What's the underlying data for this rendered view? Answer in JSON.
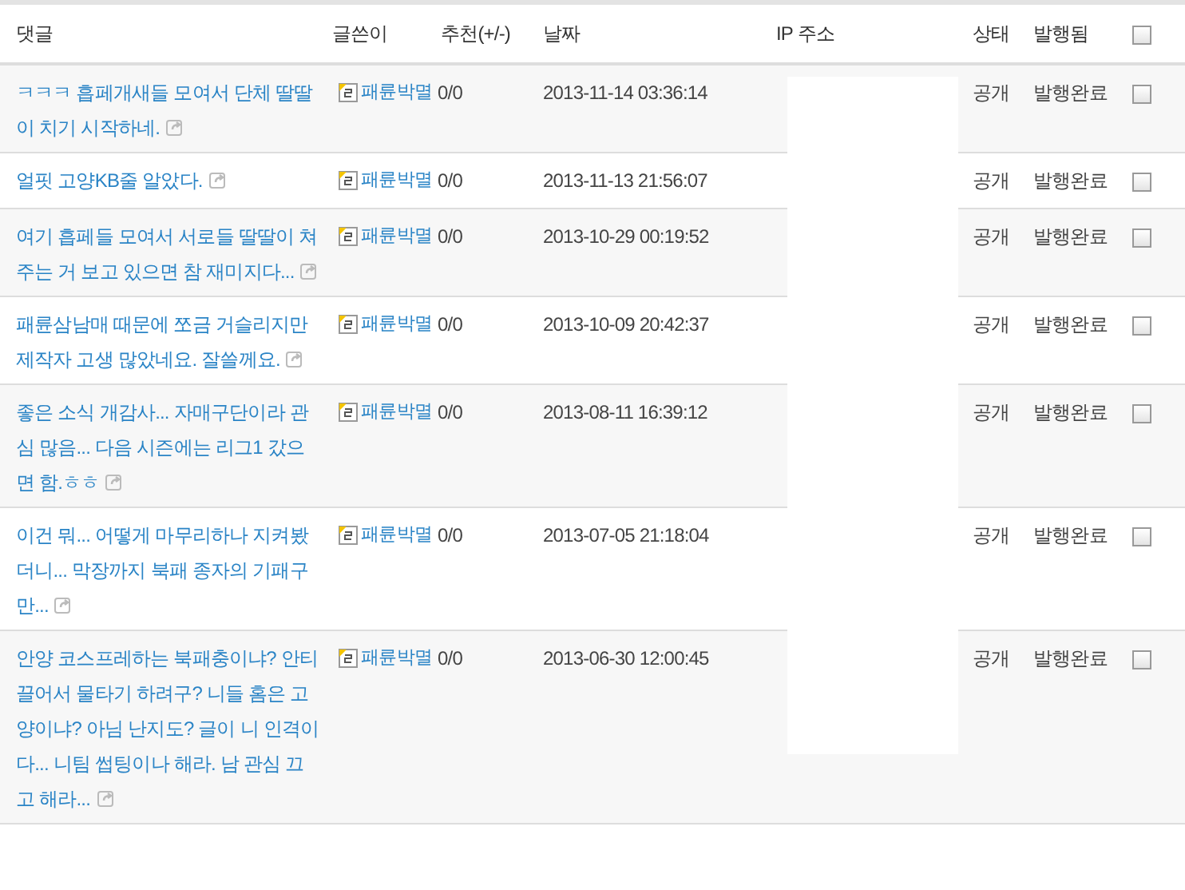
{
  "table": {
    "columns": [
      "댓글",
      "글쓴이",
      "추천(+/-)",
      "날짜",
      "IP 주소",
      "상태",
      "발행됨"
    ],
    "select_all": {
      "checked": false
    },
    "rows": [
      {
        "comment": "ㅋㅋㅋ 흡페개새들 모여서 단체 딸딸이 치기 시작하네.",
        "author": "패륜박멸",
        "votes": "0/0",
        "date": "2013-11-14 03:36:14",
        "status": "공개",
        "published": "발행완료",
        "checked": false
      },
      {
        "comment": "얼핏 고양KB줄 알았다.",
        "author": "패륜박멸",
        "votes": "0/0",
        "date": "2013-11-13 21:56:07",
        "status": "공개",
        "published": "발행완료",
        "checked": false
      },
      {
        "comment": "여기 흡페들 모여서 서로들 딸딸이 쳐주는 거 보고 있으면 참 재미지다...",
        "author": "패륜박멸",
        "votes": "0/0",
        "date": "2013-10-29 00:19:52",
        "status": "공개",
        "published": "발행완료",
        "checked": false
      },
      {
        "comment": "패륜삼남매 때문에 쪼금 거슬리지만 제작자 고생 많았네요. 잘쓸께요.",
        "author": "패륜박멸",
        "votes": "0/0",
        "date": "2013-10-09 20:42:37",
        "status": "공개",
        "published": "발행완료",
        "checked": false
      },
      {
        "comment": "좋은 소식 개감사... 자매구단이라 관심 많음... 다음 시즌에는 리그1 갔으면 함.ㅎㅎ",
        "author": "패륜박멸",
        "votes": "0/0",
        "date": "2013-08-11 16:39:12",
        "status": "공개",
        "published": "발행완료",
        "checked": false
      },
      {
        "comment": "이건 뭐... 어떻게 마무리하나 지켜봤더니... 막장까지 북패 종자의 기패구만...",
        "author": "패륜박멸",
        "votes": "0/0",
        "date": "2013-07-05 21:18:04",
        "status": "공개",
        "published": "발행완료",
        "checked": false
      },
      {
        "comment": "안양 코스프레하는 북패충이냐? 안티 끌어서 물타기 하려구? 니들 홈은 고양이냐? 아님 난지도? 글이 니 인격이다... 니팀 썹팅이나 해라. 남 관심 끄고 해라...",
        "author": "패륜박멸",
        "votes": "0/0",
        "date": "2013-06-30 12:00:45",
        "status": "공개",
        "published": "발행완료",
        "checked": false
      }
    ]
  }
}
